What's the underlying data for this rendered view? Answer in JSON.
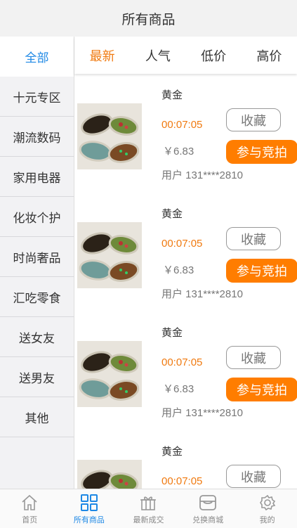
{
  "header": {
    "title": "所有商品"
  },
  "sidebar": {
    "items": [
      {
        "label": "全部"
      },
      {
        "label": "十元专区"
      },
      {
        "label": "潮流数码"
      },
      {
        "label": "家用电器"
      },
      {
        "label": "化妆个护"
      },
      {
        "label": "时尚奢品"
      },
      {
        "label": "汇吃零食"
      },
      {
        "label": "送女友"
      },
      {
        "label": "送男友"
      },
      {
        "label": "其他"
      }
    ]
  },
  "sort_tabs": [
    {
      "label": "最新"
    },
    {
      "label": "人气"
    },
    {
      "label": "低价"
    },
    {
      "label": "高价"
    }
  ],
  "products": [
    {
      "name": "黄金",
      "countdown": "00:07:05",
      "price": "￥6.83",
      "user": "用户 131****2810",
      "fav_label": "收藏",
      "bid_label": "参与竞拍"
    },
    {
      "name": "黄金",
      "countdown": "00:07:05",
      "price": "￥6.83",
      "user": "用户 131****2810",
      "fav_label": "收藏",
      "bid_label": "参与竞拍"
    },
    {
      "name": "黄金",
      "countdown": "00:07:05",
      "price": "￥6.83",
      "user": "用户 131****2810",
      "fav_label": "收藏",
      "bid_label": "参与竞拍"
    },
    {
      "name": "黄金",
      "countdown": "00:07:05",
      "fav_label": "收藏"
    }
  ],
  "tabbar": [
    {
      "label": "首页",
      "icon": "home-icon"
    },
    {
      "label": "所有商品",
      "icon": "grid-icon"
    },
    {
      "label": "最新成交",
      "icon": "gift-icon"
    },
    {
      "label": "兑换商城",
      "icon": "store-icon"
    },
    {
      "label": "我的",
      "icon": "gear-icon"
    }
  ],
  "colors": {
    "accent_blue": "#1e88e5",
    "accent_orange": "#f07a10",
    "bid_button": "#ff7d00"
  }
}
